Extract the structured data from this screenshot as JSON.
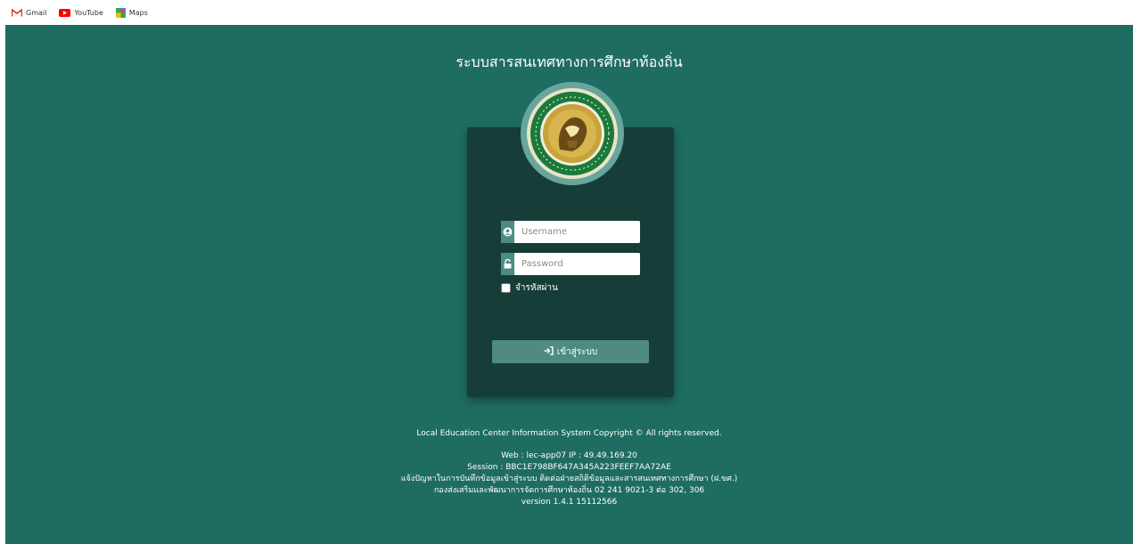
{
  "bookmarks": [
    {
      "label": "Gmail",
      "icon": "gmail-icon"
    },
    {
      "label": "YouTube",
      "icon": "youtube-icon"
    },
    {
      "label": "Maps",
      "icon": "maps-icon"
    }
  ],
  "site_title": "ระบบสารสนเทศทางการศึกษาท้องถิ่น",
  "login": {
    "username_placeholder": "Username",
    "password_placeholder": "Password",
    "remember_label": "จำรหัสผ่าน",
    "submit_label": "เข้าสู่ระบบ"
  },
  "footer": {
    "copyright": "Local Education Center Information System Copyright © All rights reserved.",
    "web_line": "Web : lec-app07 IP : 49.49.169.20",
    "session_line": "Session : BBC1E798BF647A345A223FEEF7AA72AE",
    "contact_line": "แจ้งปัญหาในการบันทึกข้อมูลเข้าสู่ระบบ ติดต่อฝ่ายสถิติข้อมูลและสารสนเทศทางการศึกษา (ฝ.ขศ.)",
    "division_line": "กองส่งเสริมและพัฒนาการจัดการศึกษาท้องถิ่น 02 241 9021-3 ต่อ 302, 306",
    "version_line": "version 1.4.1 15112566"
  },
  "colors": {
    "background": "#1f6c62",
    "card": "#163d38",
    "accent": "#4e8b82"
  }
}
